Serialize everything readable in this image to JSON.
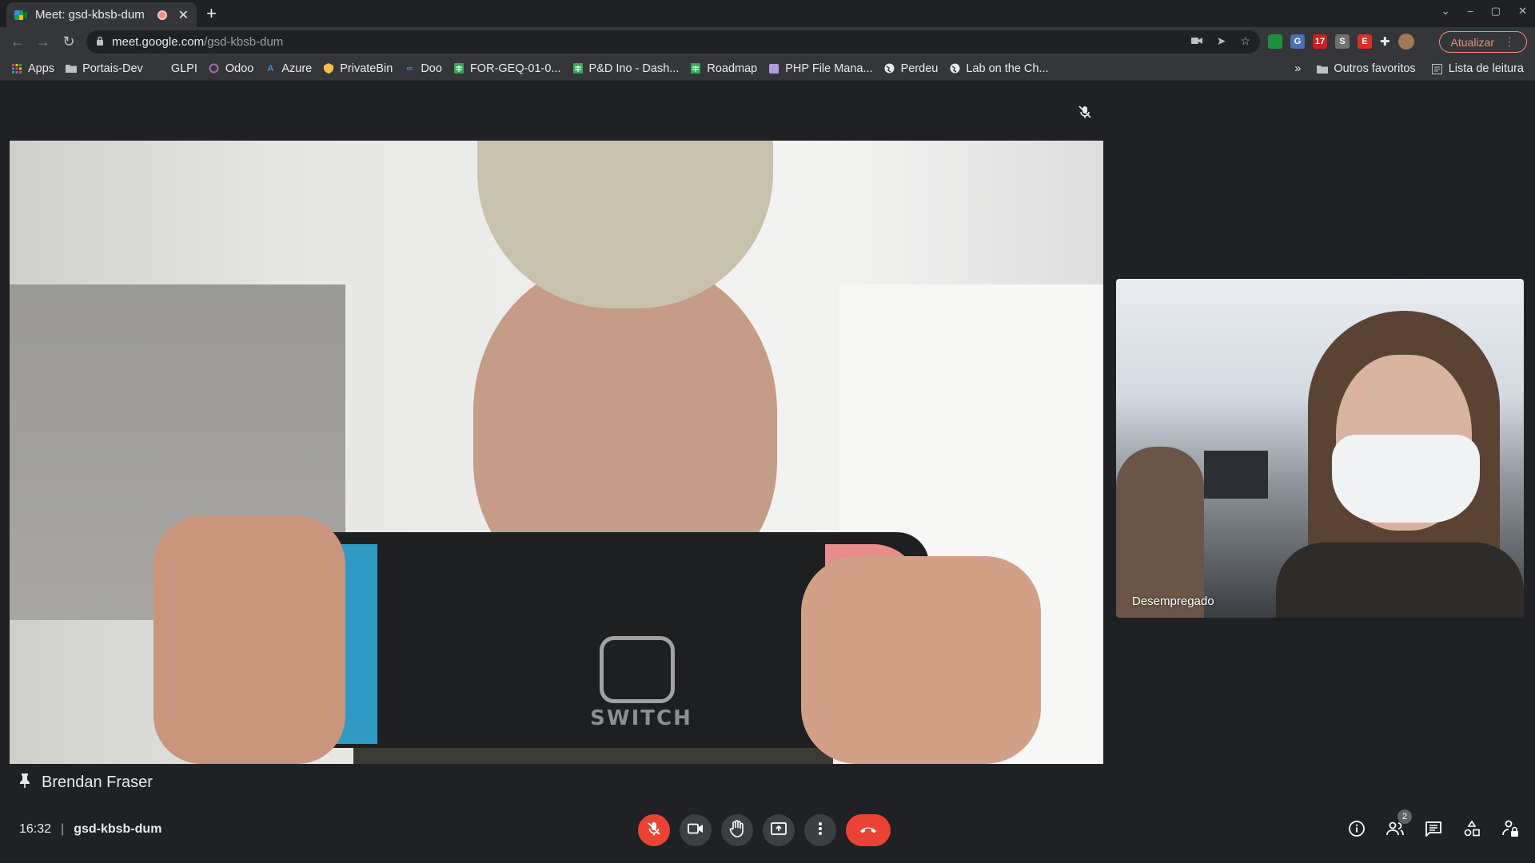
{
  "browser": {
    "tab": {
      "title": "Meet: gsd-kbsb-dum",
      "favicon": "meet-icon",
      "recording": true
    },
    "new_tab_label": "+",
    "window_controls": [
      "⌄",
      "–",
      "▢",
      "✕"
    ],
    "url": {
      "host": "meet.google.com",
      "path": "/gsd-kbsb-dum"
    },
    "update_button": "Atualizar",
    "extensions": [
      {
        "label": "",
        "color": "#1e8e3e"
      },
      {
        "label": "G",
        "color": "#4a6fb5"
      },
      {
        "label": "17",
        "color": "#c5221f"
      },
      {
        "label": "S",
        "color": "#6f6f6f"
      },
      {
        "label": "E",
        "color": "#d93025"
      }
    ]
  },
  "bookmarks": {
    "items": [
      {
        "label": "Apps",
        "icon": "apps-grid-icon",
        "color": "#e8eaed"
      },
      {
        "label": "Portais-Dev",
        "icon": "folder-icon",
        "color": "#bdc1c6"
      },
      {
        "label": "GLPI",
        "icon": "glpi-icon",
        "color": "#35363a"
      },
      {
        "label": "Odoo",
        "icon": "odoo-icon",
        "color": "#a66cb8"
      },
      {
        "label": "Azure",
        "icon": "azure-icon",
        "color": "#3a8ee6"
      },
      {
        "label": "PrivateBin",
        "icon": "privatebin-icon",
        "color": "#f2c14e"
      },
      {
        "label": "Doo",
        "icon": "doo-icon",
        "color": "#4285f4"
      },
      {
        "label": "FOR-GEQ-01-0...",
        "icon": "sheets-icon",
        "color": "#34a853"
      },
      {
        "label": "P&D Ino - Dash...",
        "icon": "sheets-icon",
        "color": "#34a853"
      },
      {
        "label": "Roadmap",
        "icon": "sheets-icon",
        "color": "#34a853"
      },
      {
        "label": "PHP File Mana...",
        "icon": "php-icon",
        "color": "#b39ddb"
      },
      {
        "label": "Perdeu",
        "icon": "globe-icon",
        "color": "#e8eaed"
      },
      {
        "label": "Lab on the Ch...",
        "icon": "globe-icon",
        "color": "#e8eaed"
      }
    ],
    "overflow": "»",
    "other_favorites": "Outros favoritos",
    "reading_list": "Lista de leitura"
  },
  "meeting": {
    "main_participant": "Brendan Fraser",
    "side_participant": "Desempregado",
    "time": "16:32",
    "separator": "|",
    "code": "gsd-kbsb-dum",
    "participants_count": "2",
    "video_text": "SWITCH"
  },
  "colors": {
    "background": "#202124",
    "accent_red": "#ea4335",
    "button_dark": "#3c4043"
  }
}
